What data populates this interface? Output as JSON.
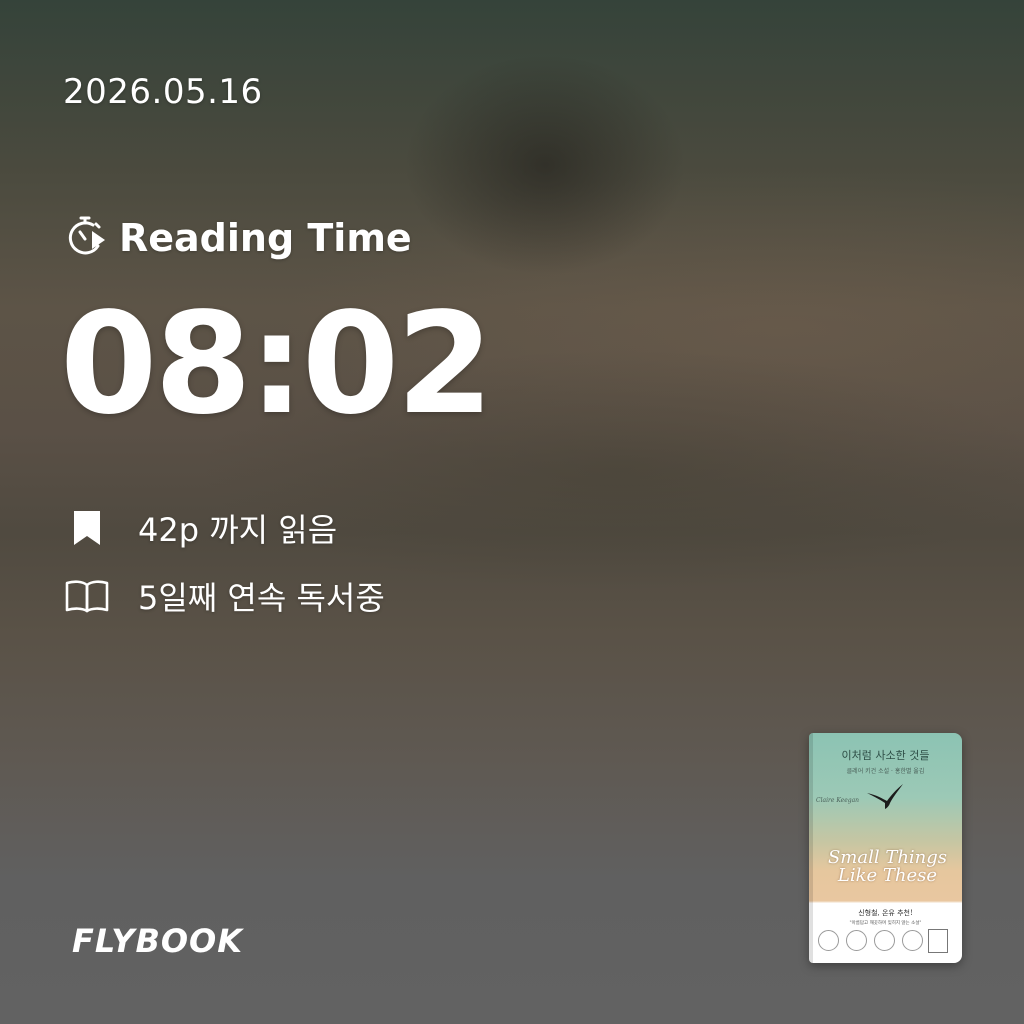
{
  "date": "2026.05.16",
  "reading_time": {
    "icon": "stopwatch-play-icon",
    "label": "Reading Time",
    "value": "08:02"
  },
  "stats": [
    {
      "icon": "bookmark-icon",
      "text": "42p 까지 읽음"
    },
    {
      "icon": "open-book-icon",
      "text": "5일째 연속 독서중"
    }
  ],
  "brand": {
    "logo": "FLYBOOK"
  },
  "book_cover": {
    "korean_title": "이처럼 사소한 것들",
    "author_line": "클레어 키건 소설 · 홍한별 옮김",
    "english_author": "Claire Keegan",
    "english_title_line1": "Small Things",
    "english_title_line2": "Like These",
    "recommendation": "신형철, 온유 추천!",
    "quote": "\"아름답고 깨끗하며 잊히지 않는 소설\""
  },
  "colors": {
    "text": "#ffffff",
    "bg_top": "#35433a",
    "bg_mid": "#5d5447",
    "bg_bottom": "#626262"
  }
}
